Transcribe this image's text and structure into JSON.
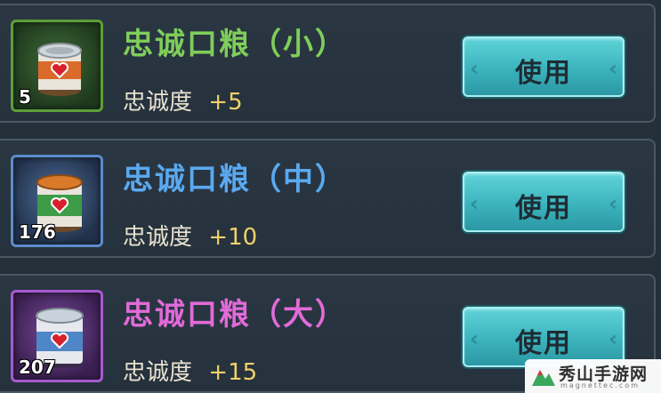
{
  "items": [
    {
      "name": "忠诚口粮（小）",
      "count": "5",
      "loyalty_label": "忠诚度",
      "loyalty_value": "+5",
      "use_label": "使用",
      "rarity_color": "#7fce5a",
      "icon": "small-can-icon"
    },
    {
      "name": "忠诚口粮（中）",
      "count": "176",
      "loyalty_label": "忠诚度",
      "loyalty_value": "+10",
      "use_label": "使用",
      "rarity_color": "#5aa9f0",
      "icon": "medium-can-icon"
    },
    {
      "name": "忠诚口粮（大）",
      "count": "207",
      "loyalty_label": "忠诚度",
      "loyalty_value": "+15",
      "use_label": "使用",
      "rarity_color": "#e26ad9",
      "icon": "large-can-icon"
    }
  ],
  "watermark": {
    "main": "秀山手游网",
    "sub": "magnettec.com"
  }
}
